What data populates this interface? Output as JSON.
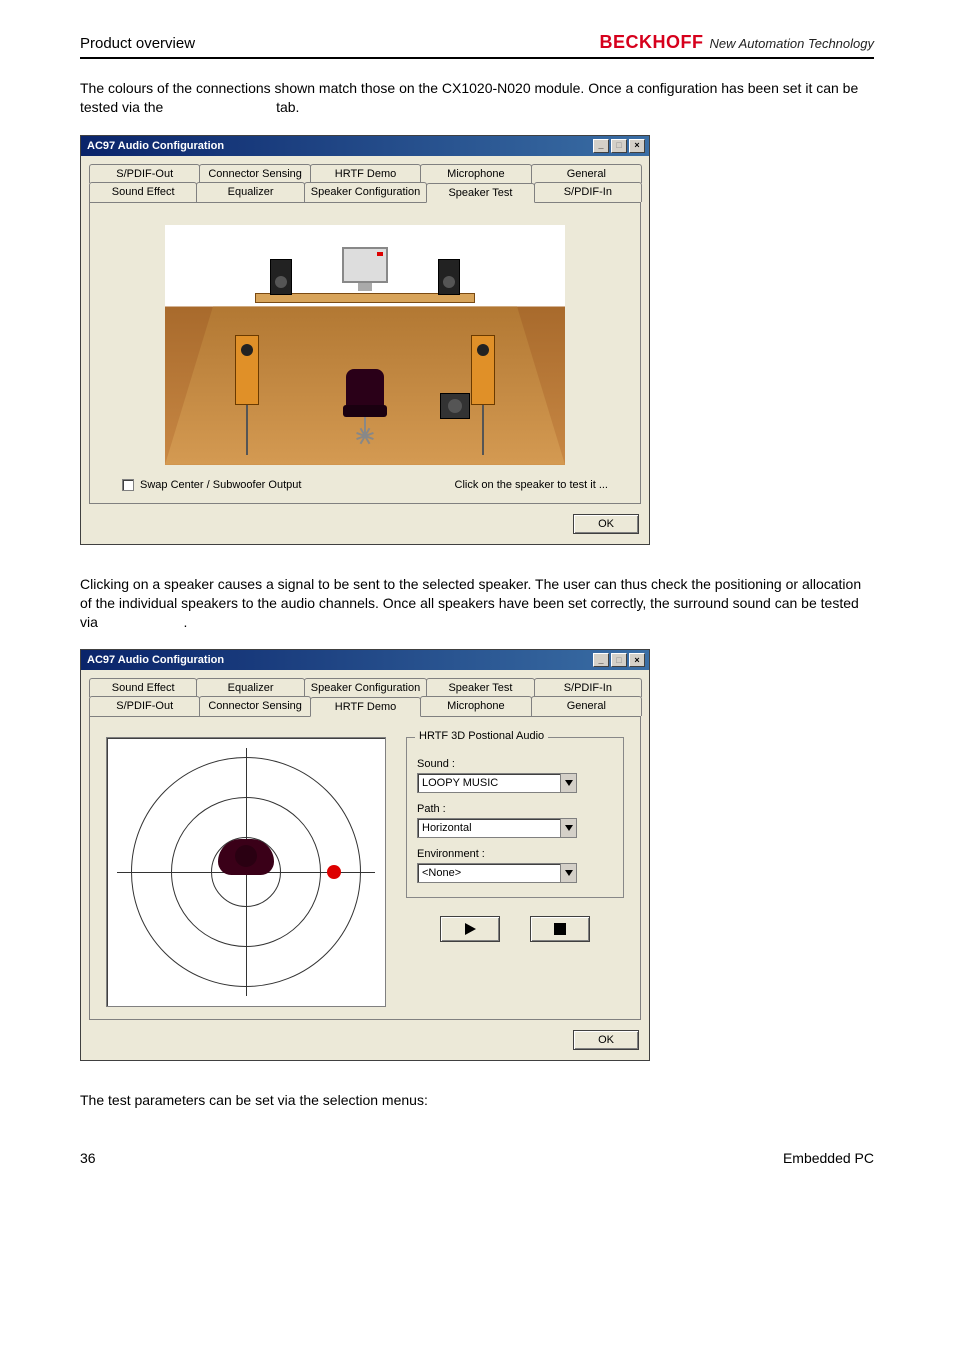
{
  "header": {
    "section": "Product overview",
    "brand": "BECKHOFF",
    "tagline": "New Automation Technology"
  },
  "paragraphs": {
    "p1": "The colours of the connections shown match those on the CX1020-N020 module. Once a configuration has been set it can be tested via the",
    "p1_suffix": "tab.",
    "p2": "Clicking on a speaker causes a signal to be sent to the selected speaker. The user can thus check the positioning or allocation of the individual speakers to the audio channels. Once all speakers have been set correctly, the surround sound can be tested via",
    "p2_suffix": ".",
    "p3": "The test parameters can be set via the selection menus:"
  },
  "dialog1": {
    "title": "AC97 Audio Configuration",
    "tabs_row1": [
      "S/PDIF-Out",
      "Connector Sensing",
      "HRTF Demo",
      "Microphone",
      "General"
    ],
    "tabs_row2": [
      "Sound Effect",
      "Equalizer",
      "Speaker Configuration",
      "Speaker Test",
      "S/PDIF-In"
    ],
    "active_tab": "Speaker Test",
    "swap_label": "Swap Center / Subwoofer Output",
    "hint": "Click on the speaker to test it ...",
    "ok": "OK"
  },
  "dialog2": {
    "title": "AC97 Audio Configuration",
    "tabs_row1": [
      "Sound Effect",
      "Equalizer",
      "Speaker Configuration",
      "Speaker Test",
      "S/PDIF-In"
    ],
    "tabs_row2": [
      "S/PDIF-Out",
      "Connector Sensing",
      "HRTF Demo",
      "Microphone",
      "General"
    ],
    "active_tab": "HRTF Demo",
    "group_label": "HRTF 3D Postional Audio",
    "sound_label": "Sound :",
    "sound_value": "LOOPY MUSIC",
    "path_label": "Path :",
    "path_value": "Horizontal",
    "env_label": "Environment :",
    "env_value": "<None>",
    "ok": "OK"
  },
  "footer": {
    "page": "36",
    "doc": "Embedded PC"
  }
}
